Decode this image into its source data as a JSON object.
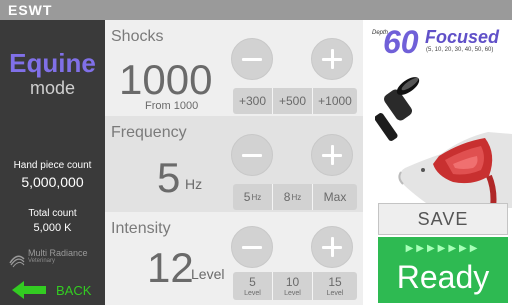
{
  "titlebar": {
    "text": "ESWT"
  },
  "left_panel": {
    "mode_name": "Equine",
    "mode_sub": "mode",
    "handpiece_label": "Hand piece count",
    "handpiece_value": "5,000,000",
    "total_label": "Total count",
    "total_value": "5,000 K",
    "logo_line1": "Multi Radiance",
    "logo_line2": "Veterinary",
    "back_label": "BACK"
  },
  "shocks": {
    "label": "Shocks",
    "value": "1000",
    "from_label": "From 1000",
    "presets": [
      "+300",
      "+500",
      "+1000"
    ]
  },
  "frequency": {
    "label": "Frequency",
    "value": "5",
    "unit": "Hz",
    "presets": [
      {
        "value": "5",
        "unit": "Hz"
      },
      {
        "value": "8",
        "unit": "Hz"
      },
      {
        "value": "Max",
        "unit": ""
      }
    ]
  },
  "intensity": {
    "label": "Intensity",
    "value": "12",
    "unit": "Level",
    "presets": [
      {
        "value": "5",
        "unit": "Level"
      },
      {
        "value": "10",
        "unit": "Level"
      },
      {
        "value": "15",
        "unit": "Level"
      }
    ]
  },
  "right_panel": {
    "depth_label": "Depth",
    "depth_value": "60",
    "focused_label": "Focused",
    "depth_options": "(5, 10, 20, 30, 40, 50, 60)",
    "save_label": "SAVE",
    "ready_arrows": "▶▶▶▶▶▶▶",
    "ready_label": "Ready"
  },
  "colors": {
    "accent_purple": "#7060d8",
    "ready_green": "#2eba52",
    "back_green": "#33cc22",
    "panel_dark": "#3a3a3a"
  },
  "icons": [
    "minus-icon",
    "plus-icon",
    "back-arrow-icon",
    "handpiece-image",
    "horse-image",
    "multi-radiance-logo"
  ]
}
